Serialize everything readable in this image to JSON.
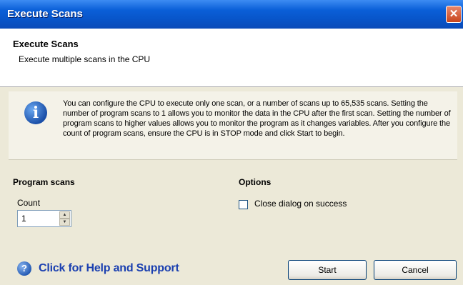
{
  "window": {
    "title": "Execute Scans",
    "close_glyph": "✕"
  },
  "header": {
    "title": "Execute Scans",
    "subtitle": "Execute multiple scans in the CPU"
  },
  "info": {
    "icon": "info-icon",
    "icon_glyph": "i",
    "text": "You can configure the CPU to execute only one scan, or a number of scans up to 65,535 scans. Setting the number of program scans to 1 allows you to monitor the data in the CPU after the first scan. Setting the number of program scans to higher values allows you to monitor the program as it changes variables. After you configure the count of program scans, ensure the CPU is in STOP mode and click Start to begin."
  },
  "program_scans": {
    "title": "Program scans",
    "count_label": "Count",
    "count_value": "1"
  },
  "options": {
    "title": "Options",
    "close_on_success_label": "Close dialog on success",
    "close_on_success_checked": false
  },
  "footer": {
    "help_icon_glyph": "?",
    "help_link": "Click for Help and Support",
    "start_label": "Start",
    "cancel_label": "Cancel"
  }
}
